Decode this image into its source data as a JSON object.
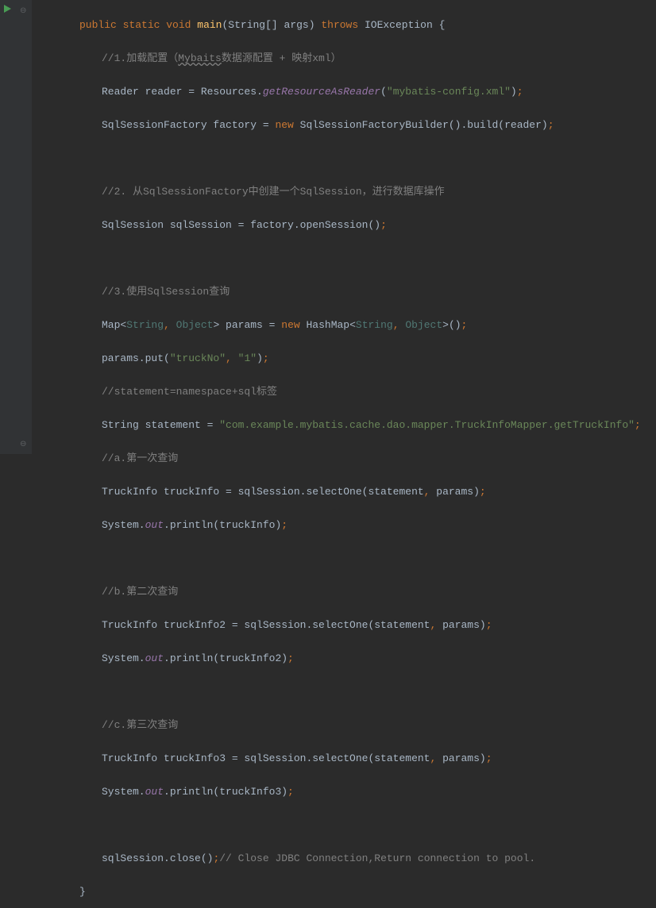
{
  "code": {
    "l1": {
      "kw_public": "public",
      "kw_static": "static",
      "kw_void": "void",
      "method": "main",
      "args": "(String[] args)",
      "kw_throws": "throws",
      "exc": "IOException {"
    },
    "l2": {
      "c_pre": "//1.加载配置（",
      "c_underline": "Mybaits",
      "c_post": "数据源配置 + 映射xml）"
    },
    "l3": {
      "pre": "Reader reader = Resources.",
      "method": "getResourceAsReader",
      "paren_open": "(",
      "str": "\"mybatis-config.xml\"",
      "paren_close": ")",
      "semi": ";"
    },
    "l4": {
      "pre": "SqlSessionFactory factory = ",
      "kw_new": "new",
      "post": " SqlSessionFactoryBuilder().build(reader)",
      "semi": ";"
    },
    "l6": {
      "c": "//2. 从SqlSessionFactory中创建一个SqlSession，进行数据库操作"
    },
    "l7": {
      "pre": "SqlSession sqlSession = factory.openSession()",
      "semi": ";"
    },
    "l9": {
      "c": "//3.使用SqlSession查询"
    },
    "l10": {
      "pre": "Map<",
      "tp1": "String",
      "comma1": ", ",
      "tp2": "Object",
      "mid": "> params = ",
      "kw_new": "new",
      "post1": " HashMap<",
      "tp3": "String",
      "comma2": ", ",
      "tp4": "Object",
      "post2": ">()",
      "semi": ";"
    },
    "l11": {
      "pre": "params.put(",
      "str1": "\"truckNo\"",
      "comma": ", ",
      "str2": "\"1\"",
      "post": ")",
      "semi": ";"
    },
    "l12": {
      "c": "//statement=namespace+sql标签"
    },
    "l13": {
      "pre": "String statement = ",
      "str": "\"com.example.mybatis.cache.dao.mapper.TruckInfoMapper.getTruckInfo\"",
      "semi": ";"
    },
    "l14": {
      "c": "//a.第一次查询"
    },
    "l15": {
      "pre": "TruckInfo truckInfo = sqlSession.selectOne(statement",
      "comma": ", ",
      "post": "params)",
      "semi": ";"
    },
    "l16": {
      "pre": "System.",
      "out": "out",
      "post": ".println(truckInfo)",
      "semi": ";"
    },
    "l18": {
      "c": "//b.第二次查询"
    },
    "l19": {
      "pre": "TruckInfo truckInfo2 = sqlSession.selectOne(statement",
      "comma": ", ",
      "post": "params)",
      "semi": ";"
    },
    "l20": {
      "pre": "System.",
      "out": "out",
      "post": ".println(truckInfo2)",
      "semi": ";"
    },
    "l22": {
      "c": "//c.第三次查询"
    },
    "l23": {
      "pre": "TruckInfo truckInfo3 = sqlSession.selectOne(statement",
      "comma": ", ",
      "post": "params)",
      "semi": ";"
    },
    "l24": {
      "pre": "System.",
      "out": "out",
      "post": ".println(truckInfo3)",
      "semi": ";"
    },
    "l26": {
      "pre": "sqlSession.close()",
      "semi": ";",
      "c": "// Close JDBC Connection,Return connection to pool."
    },
    "l27": {
      "brace": "}"
    }
  }
}
